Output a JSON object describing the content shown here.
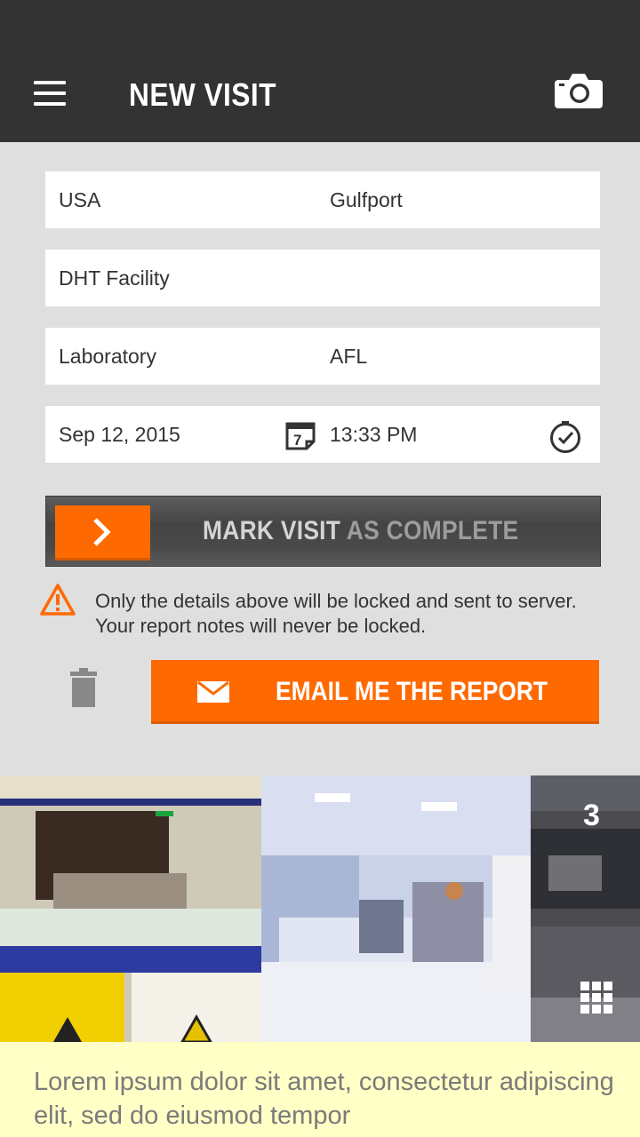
{
  "header": {
    "title": "NEW VISIT"
  },
  "location": {
    "country": "USA",
    "city": "Gulfport"
  },
  "facility": {
    "name": "DHT Facility"
  },
  "site": {
    "area": "Laboratory",
    "code": "AFL"
  },
  "datetime": {
    "date": "Sep 12, 2015",
    "time": "13:33 PM",
    "calendar_day": "7"
  },
  "complete": {
    "label_strong": "MARK VISIT",
    "label_rest": " AS COMPLETE"
  },
  "warning": {
    "text": "Only the details above will be locked and sent to server. Your report notes will never be locked."
  },
  "email": {
    "label": "EMAIL ME THE REPORT"
  },
  "gallery": {
    "count": "3"
  },
  "notes": {
    "text": "Lorem ipsum dolor sit amet, consectetur adipiscing elit, sed do eiusmod tempor"
  },
  "colors": {
    "accent": "#ff6a00",
    "appbar": "#333333",
    "background": "#dfdfdf",
    "notes_bg": "#ffffc6"
  },
  "icons": [
    "menu-icon",
    "camera-icon",
    "calendar-icon",
    "clock-icon",
    "chevron-right-icon",
    "warning-icon",
    "trash-icon",
    "envelope-icon",
    "grid-icon"
  ]
}
